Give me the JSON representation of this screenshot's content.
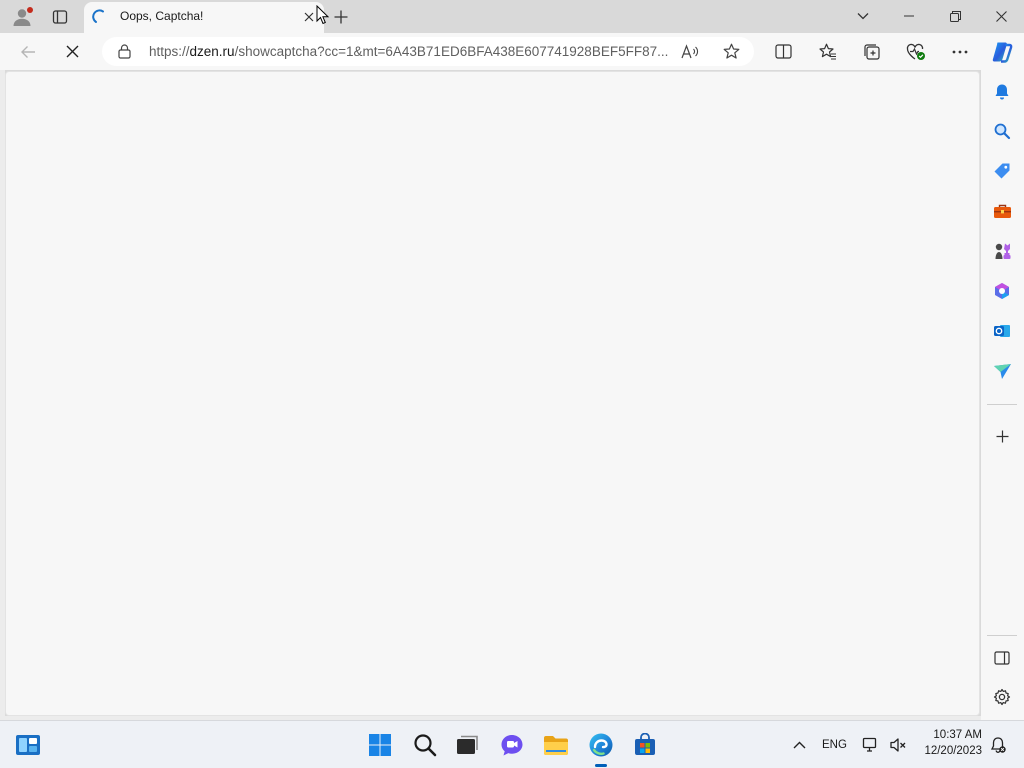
{
  "tab": {
    "title": "Oops, Captcha!"
  },
  "address": {
    "url_scheme": "https://",
    "url_host": "dzen.ru",
    "url_rest": "/showcaptcha?cc=1&mt=6A43B71ED6BFA438E607741928BEF5FF87..."
  },
  "taskbar": {
    "language": "ENG",
    "time": "10:37 AM",
    "date": "12/20/2023"
  },
  "colors": {
    "accent": "#005fb8",
    "tab_bg": "#f7f7f7",
    "strip_bg": "#d9d9d9",
    "page_bg": "#f7f7f7"
  },
  "icons": {
    "profile": "profile-icon",
    "tab_actions": "tab-actions-icon",
    "loading": "stop-loading-icon",
    "back": "back-arrow-icon",
    "read_aloud": "read-aloud-icon",
    "favorite": "star-icon",
    "split_screen": "split-screen-icon",
    "favorites": "favorites-icon",
    "collections": "collections-icon",
    "browser_essentials": "browser-essentials-icon",
    "settings_more": "more-icon",
    "copilot": "copilot-icon"
  }
}
